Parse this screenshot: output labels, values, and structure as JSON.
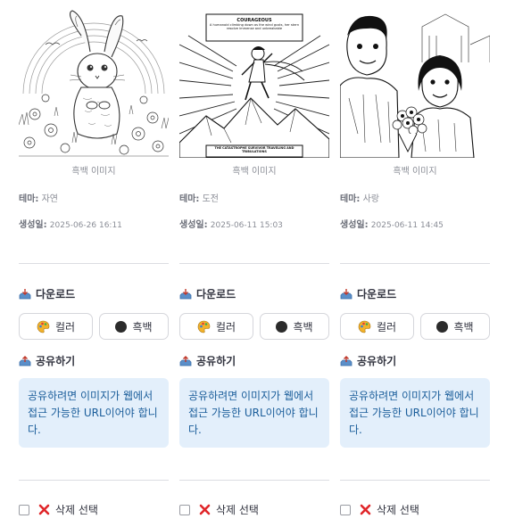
{
  "cards": [
    {
      "caption": "흑백 이미지",
      "theme_label": "테마:",
      "theme_value": "자연",
      "date_label": "생성일:",
      "date_value": "2025-06-26 16:11",
      "download_title": "다운로드",
      "color_button": "컬러",
      "bw_button": "흑백",
      "share_title": "공유하기",
      "share_info": "공유하려면 이미지가 웹에서 접근 가능한 URL이어야 합니다.",
      "delete_label": "삭제 선택"
    },
    {
      "caption": "흑백 이미지",
      "theme_label": "테마:",
      "theme_value": "도전",
      "date_label": "생성일:",
      "date_value": "2025-06-11 15:03",
      "download_title": "다운로드",
      "color_button": "컬러",
      "bw_button": "흑백",
      "share_title": "공유하기",
      "share_info": "공유하려면 이미지가 웹에서 접근 가능한 URL이어야 합니다.",
      "delete_label": "삭제 선택"
    },
    {
      "caption": "흑백 이미지",
      "theme_label": "테마:",
      "theme_value": "사랑",
      "date_label": "생성일:",
      "date_value": "2025-06-11 14:45",
      "download_title": "다운로드",
      "color_button": "컬러",
      "bw_button": "흑백",
      "share_title": "공유하기",
      "share_info": "공유하려면 이미지가 웹에서 접근 가능한 URL이어야 합니다.",
      "delete_label": "삭제 선택"
    }
  ],
  "comic_texts": {
    "top_title": "COURAGEOUS",
    "top_body": "A humanoid climbing down as the wind gusts, her stern resolve immense and unbreakable",
    "bottom_body": "THE CATASTROPHE SURVIVOR TRAVELING AND TRIBULATIONS"
  },
  "colors": {
    "info_bg": "#e3effb",
    "info_text": "#1a5d9a",
    "muted_text": "#8a8d96",
    "delete_x": "#e0262a",
    "bw_dot": "#2b2b2b",
    "palette": "#f2b22a"
  },
  "icons": {
    "download": "inbox-tray-icon",
    "share": "outbox-tray-icon",
    "color": "palette-icon",
    "bw": "black-circle-icon",
    "delete": "cross-mark-icon"
  }
}
